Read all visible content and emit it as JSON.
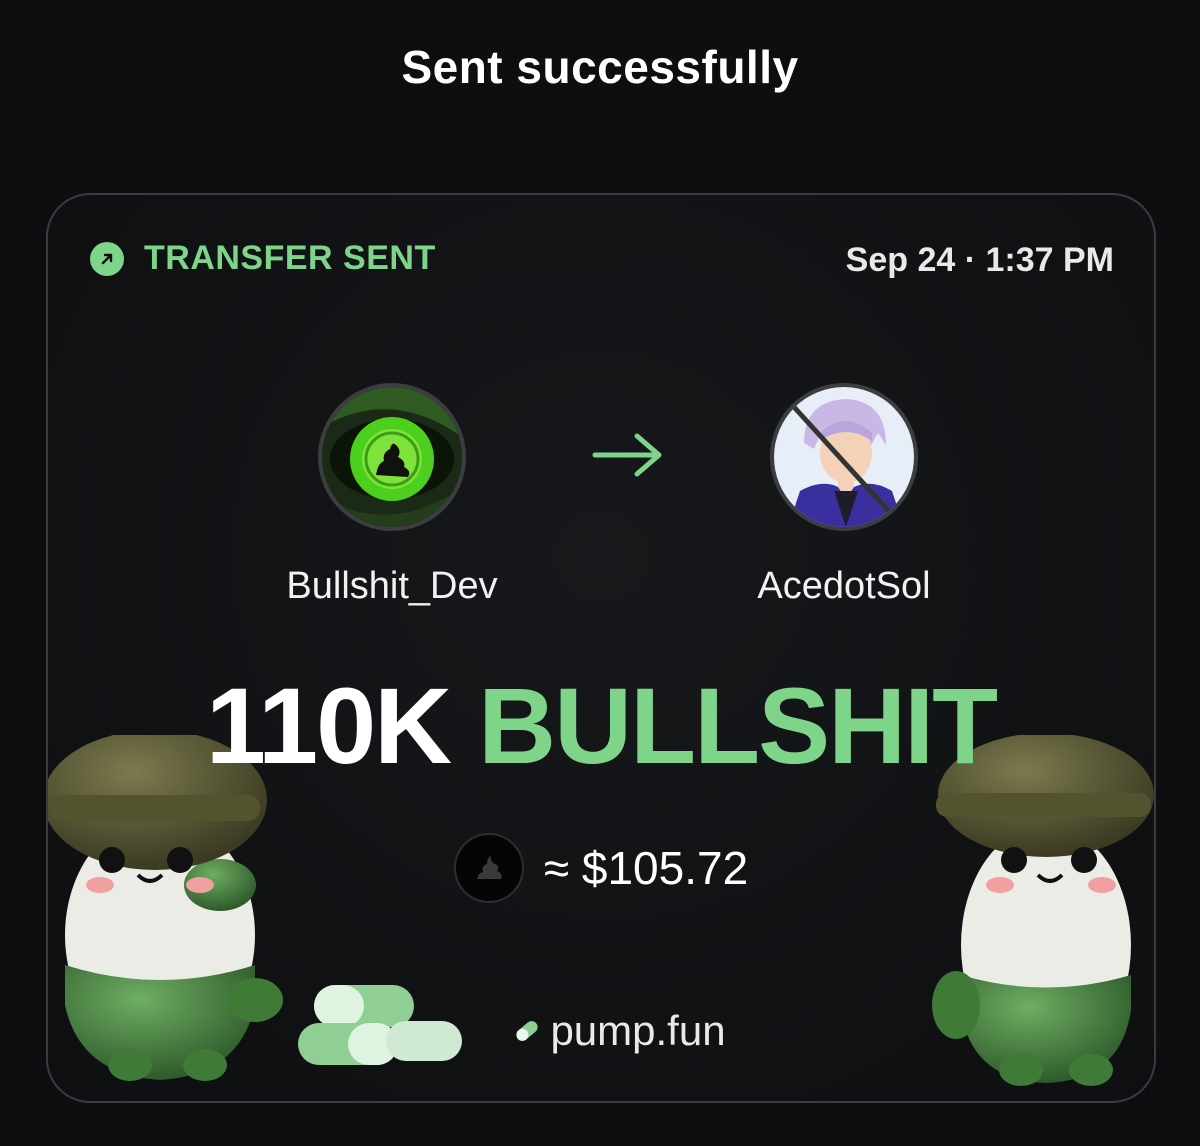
{
  "header": {
    "title": "Sent successfully"
  },
  "card": {
    "status": {
      "label": "TRANSFER SENT",
      "icon": "arrow-up-right-icon",
      "color": "#7ed58a"
    },
    "timestamp": "Sep 24 · 1:37 PM",
    "sender": {
      "name": "Bullshit_Dev",
      "avatar": "green-eye-avatar"
    },
    "receiver": {
      "name": "AcedotSol",
      "avatar": "anime-character-avatar"
    },
    "flow_icon": "arrow-right-icon",
    "amount": {
      "value": "110K",
      "token": "BULLSHIT"
    },
    "usd": {
      "text": "≈ $105.72",
      "icon": "token-poop-icon"
    },
    "brand": {
      "name": "pump.fun",
      "icon": "pill-icon"
    }
  },
  "colors": {
    "accent": "#7ed58a",
    "background": "#0d0e10",
    "card_border": "#3a3c42"
  }
}
